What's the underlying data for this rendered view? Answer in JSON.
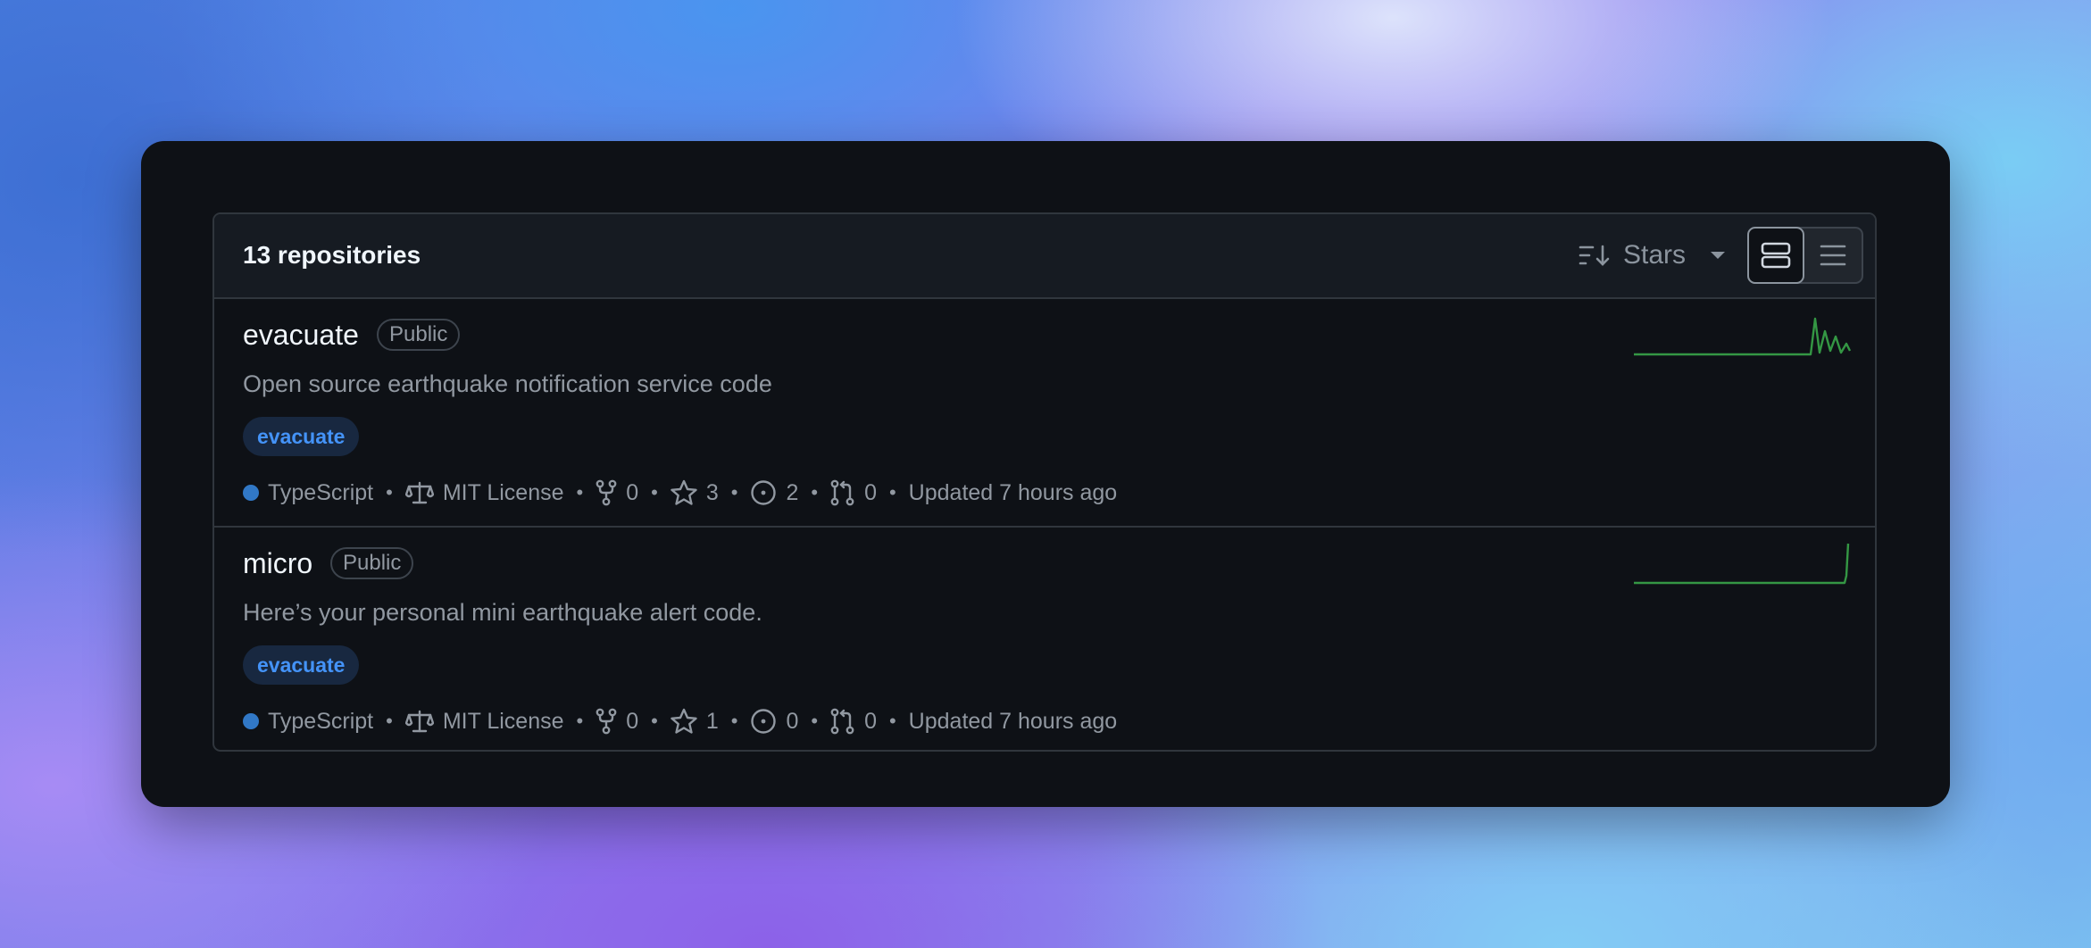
{
  "header": {
    "title": "13 repositories",
    "sort_label": "Stars"
  },
  "repos": [
    {
      "name": "evacuate",
      "visibility": "Public",
      "description": "Open source earthquake notification service code",
      "topic": "evacuate",
      "language": "TypeScript",
      "language_color": "#3178c6",
      "license": "MIT License",
      "forks": "0",
      "stars": "3",
      "issues": "2",
      "pull_requests": "0",
      "updated": "Updated 7 hours ago"
    },
    {
      "name": "micro",
      "visibility": "Public",
      "description": "Here’s your personal mini earthquake alert code.",
      "topic": "evacuate",
      "language": "TypeScript",
      "language_color": "#3178c6",
      "license": "MIT License",
      "forks": "0",
      "stars": "1",
      "issues": "0",
      "pull_requests": "0",
      "updated": "Updated 7 hours ago"
    }
  ],
  "colors": {
    "background": "#0e1116",
    "header_bg": "#161b22",
    "border": "#30363d",
    "accent_link": "#4493f8",
    "sparkline": "#3fb950"
  }
}
